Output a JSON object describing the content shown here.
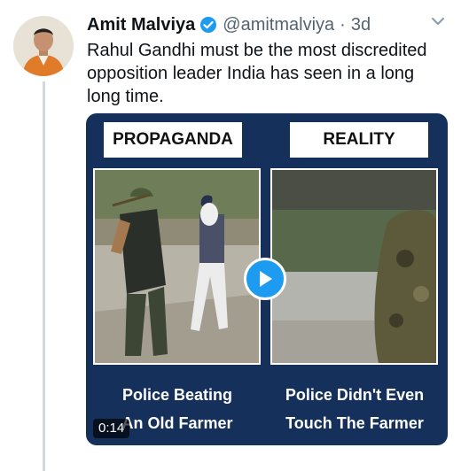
{
  "tweet": {
    "author_name": "Amit Malviya",
    "handle": "@amitmalviya",
    "separator": "·",
    "time": "3d",
    "text": "Rahul Gandhi must be the most discredited opposition leader India has seen in a long long time."
  },
  "media": {
    "left_label": "PROPAGANDA",
    "right_label": "REALITY",
    "left_caption_line1": "Police Beating",
    "left_caption_line2": "An Old Farmer",
    "right_caption_line1": "Police Didn't Even",
    "right_caption_line2": "Touch The Farmer",
    "duration": "0:14"
  },
  "icons": {
    "verified": "verified-badge-icon",
    "more": "chevron-down-icon",
    "play": "play-icon"
  },
  "colors": {
    "accent": "#1d9bf0",
    "card_bg": "#14305b",
    "thread_line": "#cfd9de"
  }
}
